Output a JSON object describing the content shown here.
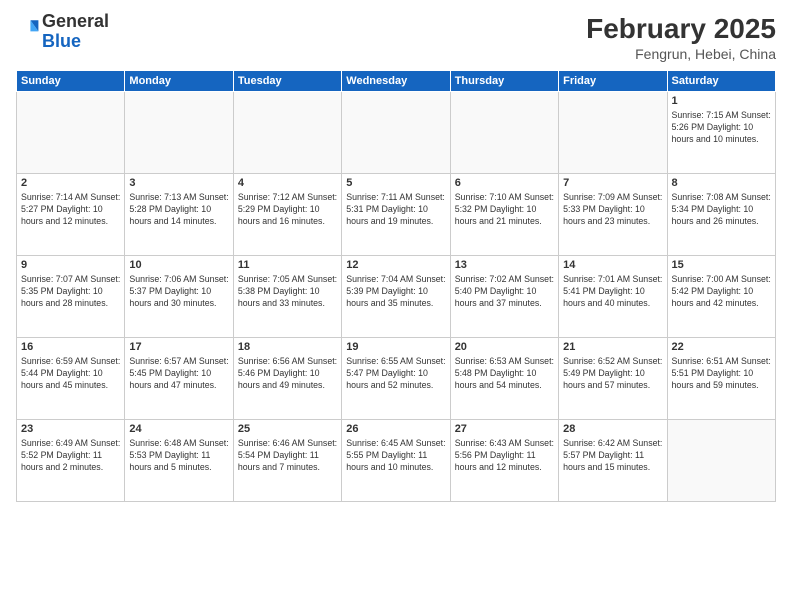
{
  "header": {
    "logo_general": "General",
    "logo_blue": "Blue",
    "month_year": "February 2025",
    "location": "Fengrun, Hebei, China"
  },
  "weekdays": [
    "Sunday",
    "Monday",
    "Tuesday",
    "Wednesday",
    "Thursday",
    "Friday",
    "Saturday"
  ],
  "weeks": [
    [
      {
        "day": "",
        "info": ""
      },
      {
        "day": "",
        "info": ""
      },
      {
        "day": "",
        "info": ""
      },
      {
        "day": "",
        "info": ""
      },
      {
        "day": "",
        "info": ""
      },
      {
        "day": "",
        "info": ""
      },
      {
        "day": "1",
        "info": "Sunrise: 7:15 AM\nSunset: 5:26 PM\nDaylight: 10 hours\nand 10 minutes."
      }
    ],
    [
      {
        "day": "2",
        "info": "Sunrise: 7:14 AM\nSunset: 5:27 PM\nDaylight: 10 hours\nand 12 minutes."
      },
      {
        "day": "3",
        "info": "Sunrise: 7:13 AM\nSunset: 5:28 PM\nDaylight: 10 hours\nand 14 minutes."
      },
      {
        "day": "4",
        "info": "Sunrise: 7:12 AM\nSunset: 5:29 PM\nDaylight: 10 hours\nand 16 minutes."
      },
      {
        "day": "5",
        "info": "Sunrise: 7:11 AM\nSunset: 5:31 PM\nDaylight: 10 hours\nand 19 minutes."
      },
      {
        "day": "6",
        "info": "Sunrise: 7:10 AM\nSunset: 5:32 PM\nDaylight: 10 hours\nand 21 minutes."
      },
      {
        "day": "7",
        "info": "Sunrise: 7:09 AM\nSunset: 5:33 PM\nDaylight: 10 hours\nand 23 minutes."
      },
      {
        "day": "8",
        "info": "Sunrise: 7:08 AM\nSunset: 5:34 PM\nDaylight: 10 hours\nand 26 minutes."
      }
    ],
    [
      {
        "day": "9",
        "info": "Sunrise: 7:07 AM\nSunset: 5:35 PM\nDaylight: 10 hours\nand 28 minutes."
      },
      {
        "day": "10",
        "info": "Sunrise: 7:06 AM\nSunset: 5:37 PM\nDaylight: 10 hours\nand 30 minutes."
      },
      {
        "day": "11",
        "info": "Sunrise: 7:05 AM\nSunset: 5:38 PM\nDaylight: 10 hours\nand 33 minutes."
      },
      {
        "day": "12",
        "info": "Sunrise: 7:04 AM\nSunset: 5:39 PM\nDaylight: 10 hours\nand 35 minutes."
      },
      {
        "day": "13",
        "info": "Sunrise: 7:02 AM\nSunset: 5:40 PM\nDaylight: 10 hours\nand 37 minutes."
      },
      {
        "day": "14",
        "info": "Sunrise: 7:01 AM\nSunset: 5:41 PM\nDaylight: 10 hours\nand 40 minutes."
      },
      {
        "day": "15",
        "info": "Sunrise: 7:00 AM\nSunset: 5:42 PM\nDaylight: 10 hours\nand 42 minutes."
      }
    ],
    [
      {
        "day": "16",
        "info": "Sunrise: 6:59 AM\nSunset: 5:44 PM\nDaylight: 10 hours\nand 45 minutes."
      },
      {
        "day": "17",
        "info": "Sunrise: 6:57 AM\nSunset: 5:45 PM\nDaylight: 10 hours\nand 47 minutes."
      },
      {
        "day": "18",
        "info": "Sunrise: 6:56 AM\nSunset: 5:46 PM\nDaylight: 10 hours\nand 49 minutes."
      },
      {
        "day": "19",
        "info": "Sunrise: 6:55 AM\nSunset: 5:47 PM\nDaylight: 10 hours\nand 52 minutes."
      },
      {
        "day": "20",
        "info": "Sunrise: 6:53 AM\nSunset: 5:48 PM\nDaylight: 10 hours\nand 54 minutes."
      },
      {
        "day": "21",
        "info": "Sunrise: 6:52 AM\nSunset: 5:49 PM\nDaylight: 10 hours\nand 57 minutes."
      },
      {
        "day": "22",
        "info": "Sunrise: 6:51 AM\nSunset: 5:51 PM\nDaylight: 10 hours\nand 59 minutes."
      }
    ],
    [
      {
        "day": "23",
        "info": "Sunrise: 6:49 AM\nSunset: 5:52 PM\nDaylight: 11 hours\nand 2 minutes."
      },
      {
        "day": "24",
        "info": "Sunrise: 6:48 AM\nSunset: 5:53 PM\nDaylight: 11 hours\nand 5 minutes."
      },
      {
        "day": "25",
        "info": "Sunrise: 6:46 AM\nSunset: 5:54 PM\nDaylight: 11 hours\nand 7 minutes."
      },
      {
        "day": "26",
        "info": "Sunrise: 6:45 AM\nSunset: 5:55 PM\nDaylight: 11 hours\nand 10 minutes."
      },
      {
        "day": "27",
        "info": "Sunrise: 6:43 AM\nSunset: 5:56 PM\nDaylight: 11 hours\nand 12 minutes."
      },
      {
        "day": "28",
        "info": "Sunrise: 6:42 AM\nSunset: 5:57 PM\nDaylight: 11 hours\nand 15 minutes."
      },
      {
        "day": "",
        "info": ""
      }
    ]
  ]
}
